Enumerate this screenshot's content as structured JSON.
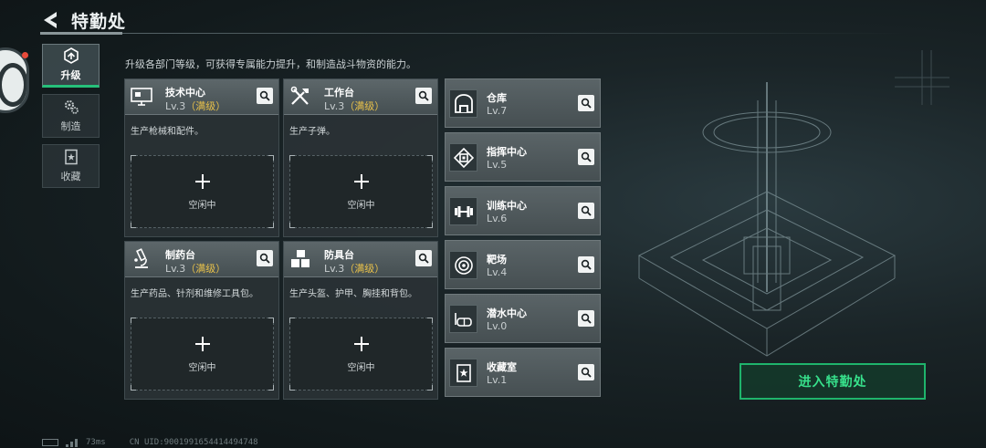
{
  "header": {
    "title": "特勤处"
  },
  "side_nav": [
    {
      "label": "升级",
      "icon": "upgrade-icon",
      "active": true
    },
    {
      "label": "制造",
      "icon": "gears-icon",
      "active": false
    },
    {
      "label": "收藏",
      "icon": "collection-icon",
      "active": false
    }
  ],
  "subtitle": "升级各部门等级，可获得专属能力提升，和制造战斗物资的能力。",
  "departments": [
    {
      "name": "技术中心",
      "level": "Lv.3",
      "max_tag": "（满级）",
      "desc": "生产枪械和配件。",
      "slot_label": "空闲中",
      "icon": "monitor-icon"
    },
    {
      "name": "工作台",
      "level": "Lv.3",
      "max_tag": "（满级）",
      "desc": "生产子弹。",
      "slot_label": "空闲中",
      "icon": "tools-icon"
    },
    {
      "name": "制药台",
      "level": "Lv.3",
      "max_tag": "（满级）",
      "desc": "生产药品、针剂和维修工具包。",
      "slot_label": "空闲中",
      "icon": "microscope-icon"
    },
    {
      "name": "防具台",
      "level": "Lv.3",
      "max_tag": "（满级）",
      "desc": "生产头盔、护甲、胸挂和背包。",
      "slot_label": "空闲中",
      "icon": "cubes-icon"
    }
  ],
  "facilities": [
    {
      "name": "仓库",
      "level": "Lv.7",
      "icon": "warehouse-icon"
    },
    {
      "name": "指挥中心",
      "level": "Lv.5",
      "icon": "chip-icon"
    },
    {
      "name": "训练中心",
      "level": "Lv.6",
      "icon": "dumbbell-icon"
    },
    {
      "name": "靶场",
      "level": "Lv.4",
      "icon": "target-icon"
    },
    {
      "name": "潜水中心",
      "level": "Lv.0",
      "icon": "diving-mask-icon"
    },
    {
      "name": "收藏室",
      "level": "Lv.1",
      "icon": "collection-icon"
    }
  ],
  "enter_button": "进入特勤处",
  "footer": {
    "ping": "73ms",
    "uid": "CN UID:9001991654414494748"
  },
  "colors": {
    "accent_green": "#1fb46c",
    "max_yellow": "#e8c14a",
    "notify_red": "#e84a3a"
  }
}
